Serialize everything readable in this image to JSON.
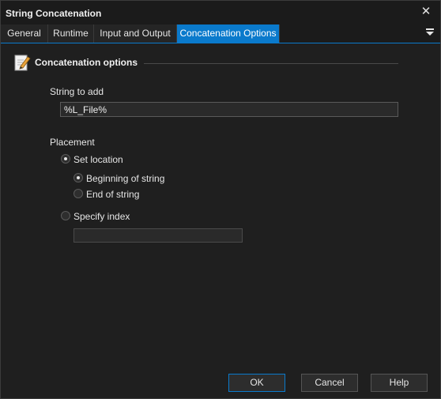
{
  "window": {
    "title": "String Concatenation"
  },
  "tabs": [
    {
      "label": "General"
    },
    {
      "label": "Runtime"
    },
    {
      "label": "Input and Output"
    },
    {
      "label": "Concatenation Options",
      "active": true
    }
  ],
  "section": {
    "title": "Concatenation options"
  },
  "string_to_add": {
    "label": "String to add",
    "value": "%L_File%"
  },
  "placement": {
    "label": "Placement",
    "set_location": {
      "label": "Set location",
      "checked": true
    },
    "beginning": {
      "label": "Beginning of string",
      "checked": true
    },
    "end": {
      "label": "End of string",
      "checked": false
    },
    "specify_index": {
      "label": "Specify index",
      "checked": false,
      "value": ""
    }
  },
  "buttons": {
    "ok": "OK",
    "cancel": "Cancel",
    "help": "Help"
  },
  "colors": {
    "accent": "#0a7acc",
    "background": "#1f1f1f"
  }
}
